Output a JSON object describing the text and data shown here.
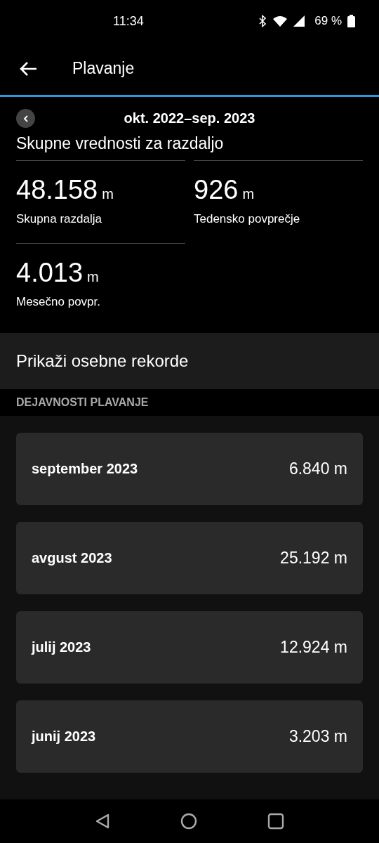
{
  "status_bar": {
    "time": "11:34",
    "battery": "69 %"
  },
  "app_bar": {
    "title": "Plavanje"
  },
  "period": {
    "label": "okt. 2022–sep. 2023"
  },
  "totals": {
    "heading": "Skupne vrednosti za razdaljo",
    "stats": [
      {
        "value": "48.158",
        "unit": "m",
        "label": "Skupna razdalja"
      },
      {
        "value": "926",
        "unit": "m",
        "label": "Tedensko povprečje"
      },
      {
        "value": "4.013",
        "unit": "m",
        "label": "Mesečno povpr."
      }
    ]
  },
  "records_link": "Prikaži osebne rekorde",
  "activities": {
    "heading": "DEJAVNOSTI PLAVANJE",
    "months": [
      {
        "month": "september 2023",
        "distance": "6.840 m"
      },
      {
        "month": "avgust 2023",
        "distance": "25.192 m"
      },
      {
        "month": "julij 2023",
        "distance": "12.924 m"
      },
      {
        "month": "junij 2023",
        "distance": "3.203 m"
      }
    ]
  }
}
